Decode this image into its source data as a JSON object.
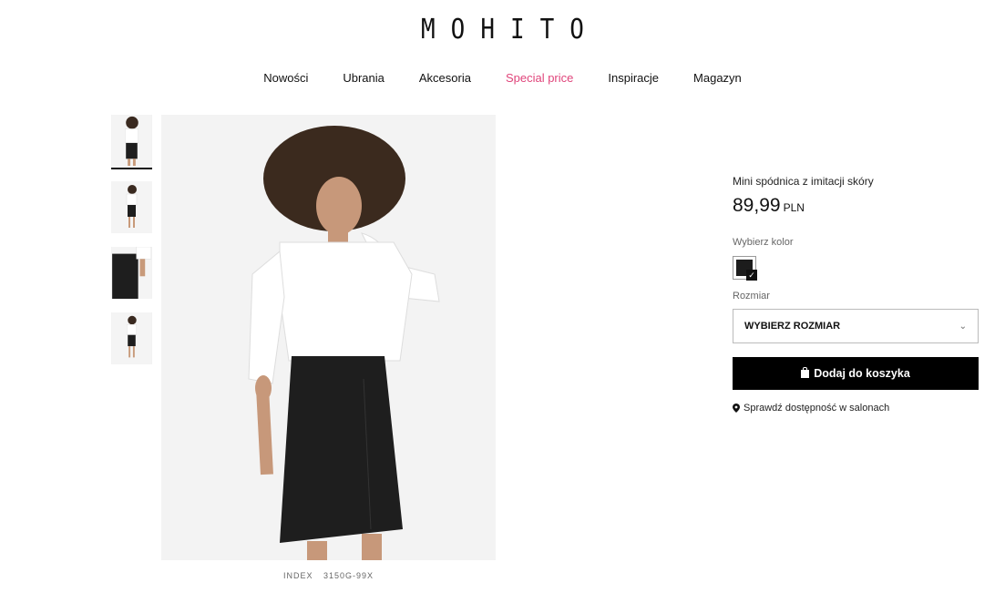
{
  "brand": {
    "logo": "MOHITO"
  },
  "nav": {
    "items": [
      "Nowości",
      "Ubrania",
      "Akcesoria",
      "Special price",
      "Inspiracje",
      "Magazyn"
    ]
  },
  "product": {
    "title": "Mini spódnica z imitacji skóry",
    "price": "89,99",
    "currency": "PLN",
    "color_label": "Wybierz kolor",
    "selected_color": "#1c1c1c",
    "size_label": "Rozmiar",
    "size_placeholder": "WYBIERZ ROZMIAR",
    "add_to_cart": "Dodaj do koszyka",
    "store_availability": "Sprawdź dostępność w salonach",
    "index_label": "INDEX",
    "index_value": "3150G-99X"
  },
  "colors": {
    "accent": "#e0457b",
    "button_bg": "#000000"
  },
  "icons": {
    "chevron": "chevron-down-icon",
    "bag": "shopping-bag-icon",
    "pin": "map-pin-icon"
  }
}
